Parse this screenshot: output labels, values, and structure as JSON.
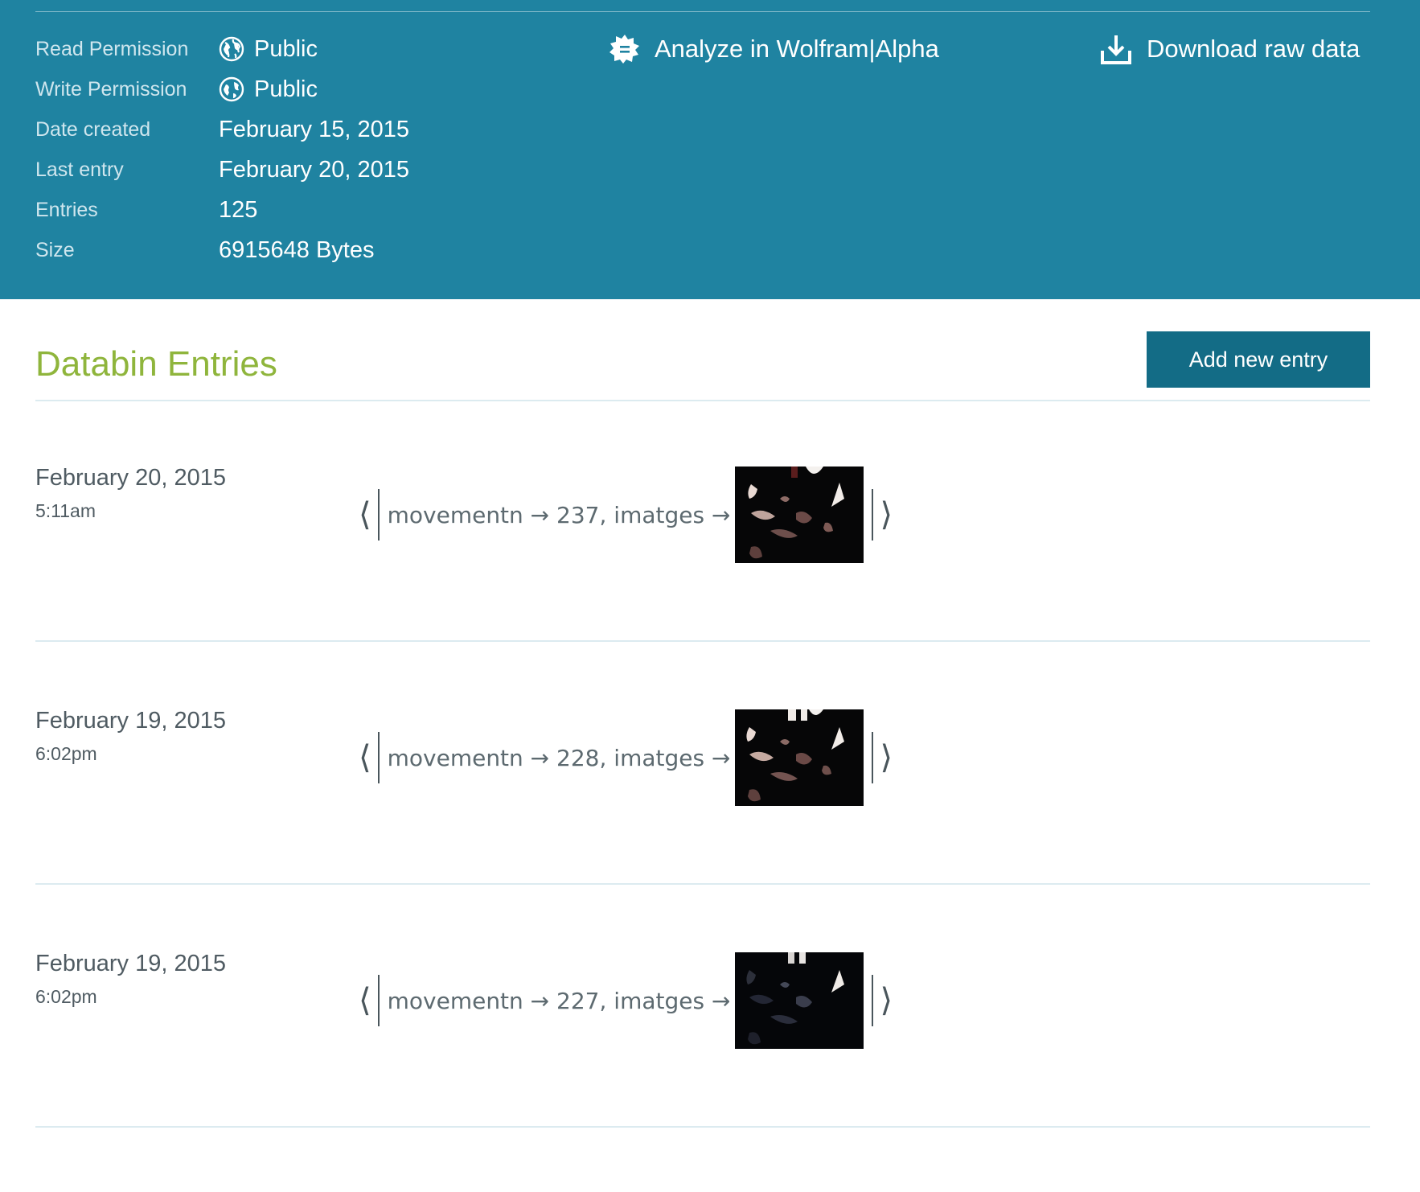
{
  "metadata": {
    "rows": [
      {
        "label": "Read Permission",
        "value": "Public",
        "icon": "globe-icon"
      },
      {
        "label": "Write Permission",
        "value": "Public",
        "icon": "globe-icon"
      },
      {
        "label": "Date created",
        "value": "February 15, 2015"
      },
      {
        "label": "Last entry",
        "value": "February 20, 2015"
      },
      {
        "label": "Entries",
        "value": "125"
      },
      {
        "label": "Size",
        "value": "6915648 Bytes"
      }
    ]
  },
  "actions": {
    "analyze_label": "Analyze in Wolfram|Alpha",
    "analyze_icon": "wolfram-star-icon",
    "download_label": "Download raw data",
    "download_icon": "download-icon"
  },
  "section": {
    "title": "Databin Entries",
    "add_button_label": "Add new entry"
  },
  "entries": [
    {
      "date": "February 20, 2015",
      "time": "5:11am",
      "text": "movementn → 237, imatges →"
    },
    {
      "date": "February 19, 2015",
      "time": "6:02pm",
      "text": "movementn → 228, imatges →"
    },
    {
      "date": "February 19, 2015",
      "time": "6:02pm",
      "text": "movementn → 227, imatges →"
    }
  ],
  "colors": {
    "band": "#1f83a1",
    "title_green": "#8fb53c",
    "button": "#136c86"
  }
}
